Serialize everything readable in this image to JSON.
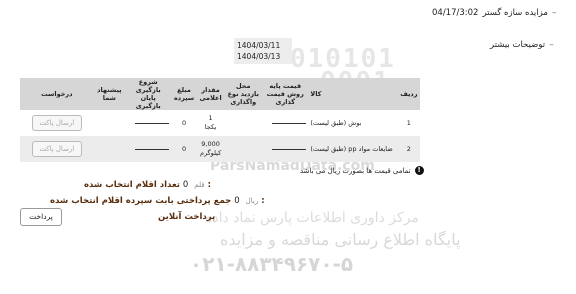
{
  "header": {
    "date": "04/17/3:02",
    "title": "مزایده سازه گستر"
  },
  "more_details": "توضیحات بیشتر",
  "dates": [
    "1404/03/11",
    "1404/03/13"
  ],
  "table": {
    "headers": {
      "idx": "ردیف",
      "desc": "کالا",
      "base": "قیمت پایه روش قیمت گذاری",
      "visit": "محل بازدید نوع واگذاری",
      "qty": "مقدار اعلامی",
      "deposit": "مبلغ سپرده",
      "start": "شروع بازگیری پایان بازگیری",
      "offer": "پیشنهاد شما",
      "request": "درخواست"
    },
    "rows": [
      {
        "idx": "1",
        "desc": "بوش (طبق لیست)",
        "qty": "1",
        "unit": "یکجا",
        "deposit": "0",
        "button": "ارسال پاکت"
      },
      {
        "idx": "2",
        "desc": "ضایعات مواد pp (طبق لیست)",
        "qty": "9,000",
        "unit": "کیلوگرم",
        "deposit": "0",
        "button": "ارسال پاکت"
      }
    ]
  },
  "note": "تمامی قیمت ها بصورت ریال می باشد",
  "summary": {
    "count_label": "تعداد اقلام انتخاب شده:",
    "count_value": "0",
    "count_unit": "قلم",
    "deposit_label": "جمع پرداختی بابت سپرده اقلام انتخاب شده:",
    "deposit_value": "0",
    "deposit_unit": "ریال",
    "online_label": "پرداخت آنلاین"
  },
  "pay_button": "پرداخت",
  "watermark": {
    "digits_1": "010101",
    "digits_2": "0001",
    "site": "ParsNamadData.com",
    "line_1": "مرکز داوری اطلاعات پارس نماد داده",
    "line_2": "پایگاه اطلاع رسانی مناقصه و مزایده",
    "phone": "۰۲۱-۸۸۳۴۹۶۷۰-۵"
  },
  "colors": {
    "header_bg": "#d6d6d6",
    "summary_text": "#5a2d0c",
    "alt_row": "#ececec"
  }
}
